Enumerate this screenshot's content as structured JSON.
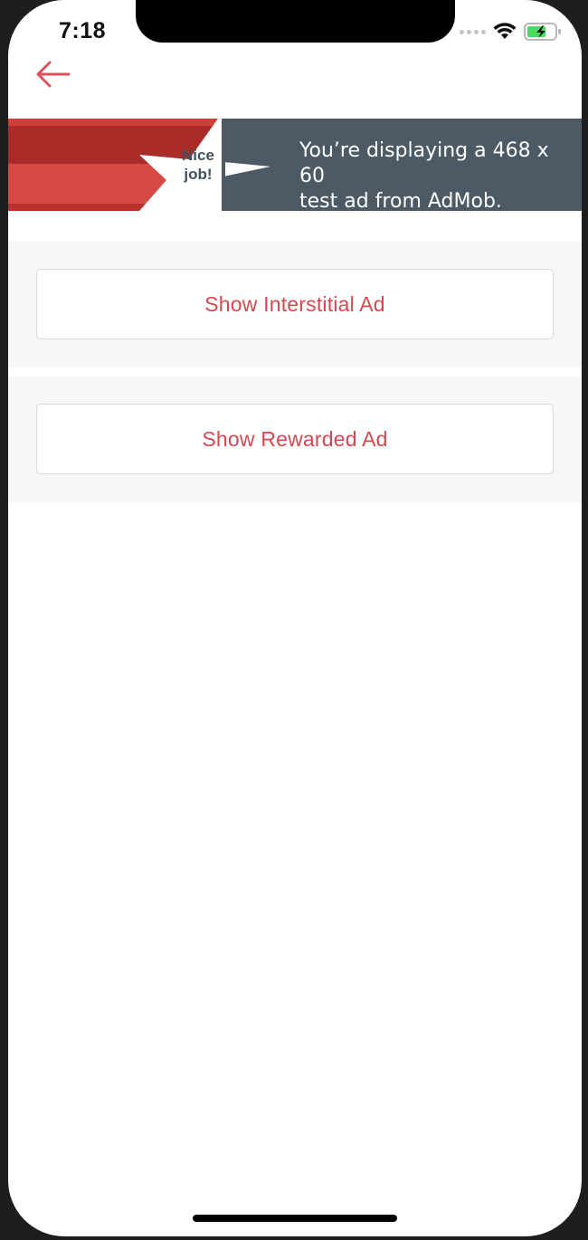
{
  "status_bar": {
    "time": "7:18",
    "icons": [
      "cellular-signal-icon",
      "wifi-icon",
      "battery-charging-icon"
    ]
  },
  "nav": {
    "back_icon": "arrow-left-icon",
    "accent_color": "#e0525a"
  },
  "ad_banner": {
    "badge_line1": "Nice",
    "badge_line2": "job!",
    "message_line1": "You’re displaying a 468 x 60",
    "message_line2": "test ad from AdMob."
  },
  "actions": {
    "interstitial_label": "Show Interstitial Ad",
    "rewarded_label": "Show Rewarded Ad"
  },
  "colors": {
    "button_text": "#d6474f",
    "section_background": "#f7f7f7",
    "ad_dark": "#4b5a65",
    "ad_red": "#d54a43"
  }
}
